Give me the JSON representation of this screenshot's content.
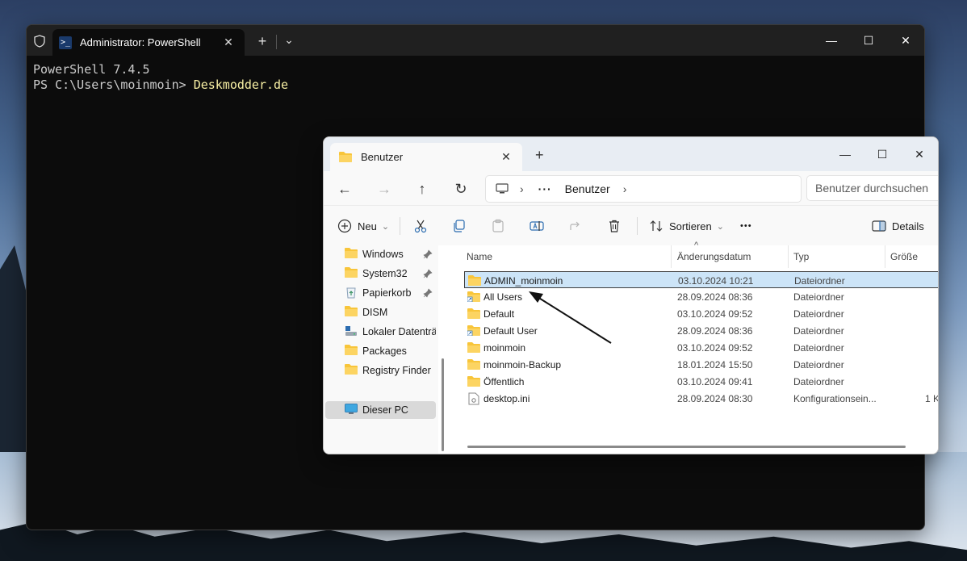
{
  "terminal": {
    "tab_title": "Administrator: PowerShell",
    "close_glyph": "✕",
    "new_tab_glyph": "+",
    "dropdown_glyph": "⌄",
    "minimize_glyph": "—",
    "maximize_glyph": "☐",
    "window_close_glyph": "✕",
    "line1": "PowerShell 7.4.5",
    "prompt": "PS C:\\Users\\moinmoin> ",
    "command": "Deskmodder.de"
  },
  "explorer": {
    "tab_title": "Benutzer",
    "tab_close_glyph": "✕",
    "new_tab_glyph": "+",
    "minimize_glyph": "—",
    "maximize_glyph": "☐",
    "close_glyph": "✕",
    "nav": {
      "back": "←",
      "forward": "→",
      "up": "↑",
      "refresh": "↻"
    },
    "address": {
      "more": "···",
      "chev1": "›",
      "location": "Benutzer",
      "chev2": "›"
    },
    "search_placeholder": "Benutzer durchsuchen",
    "commands": {
      "new": "Neu",
      "sort": "Sortieren",
      "more": "•••",
      "details": "Details",
      "dropdown_glyph": "⌄"
    },
    "sidebar": [
      {
        "label": "Windows",
        "icon": "folder-icon",
        "pinned": true
      },
      {
        "label": "System32",
        "icon": "folder-icon",
        "pinned": true
      },
      {
        "label": "Papierkorb",
        "icon": "recycle-bin-icon",
        "pinned": true
      },
      {
        "label": "DISM",
        "icon": "folder-icon",
        "pinned": false
      },
      {
        "label": "Lokaler Datenträg",
        "icon": "drive-icon",
        "pinned": false
      },
      {
        "label": "Packages",
        "icon": "folder-icon",
        "pinned": false
      },
      {
        "label": "Registry Finder",
        "icon": "folder-icon",
        "pinned": false
      },
      {
        "label": "Dieser PC",
        "icon": "pc-icon",
        "pinned": false
      }
    ],
    "columns": {
      "name": "Name",
      "date": "Änderungsdatum",
      "type": "Typ",
      "size": "Größe",
      "sort_glyph": "^"
    },
    "files": [
      {
        "name": "ADMIN_moinmoin",
        "date": "03.10.2024 10:21",
        "type": "Dateiordner",
        "size": "",
        "icon": "folder-icon"
      },
      {
        "name": "All Users",
        "date": "28.09.2024 08:36",
        "type": "Dateiordner",
        "size": "",
        "icon": "folder-shortcut-icon"
      },
      {
        "name": "Default",
        "date": "03.10.2024 09:52",
        "type": "Dateiordner",
        "size": "",
        "icon": "folder-icon"
      },
      {
        "name": "Default User",
        "date": "28.09.2024 08:36",
        "type": "Dateiordner",
        "size": "",
        "icon": "folder-shortcut-icon"
      },
      {
        "name": "moinmoin",
        "date": "03.10.2024 09:52",
        "type": "Dateiordner",
        "size": "",
        "icon": "folder-icon"
      },
      {
        "name": "moinmoin-Backup",
        "date": "18.01.2024 15:50",
        "type": "Dateiordner",
        "size": "",
        "icon": "folder-icon"
      },
      {
        "name": "Öffentlich",
        "date": "03.10.2024 09:41",
        "type": "Dateiordner",
        "size": "",
        "icon": "folder-icon"
      },
      {
        "name": "desktop.ini",
        "date": "28.09.2024 08:30",
        "type": "Konfigurationsein...",
        "size": "1 K",
        "icon": "settings-file-icon"
      }
    ]
  },
  "colors": {
    "folder": "#f8c53a",
    "selected_row": "#cce4f7",
    "terminal_cmd": "#f9f1a5"
  }
}
